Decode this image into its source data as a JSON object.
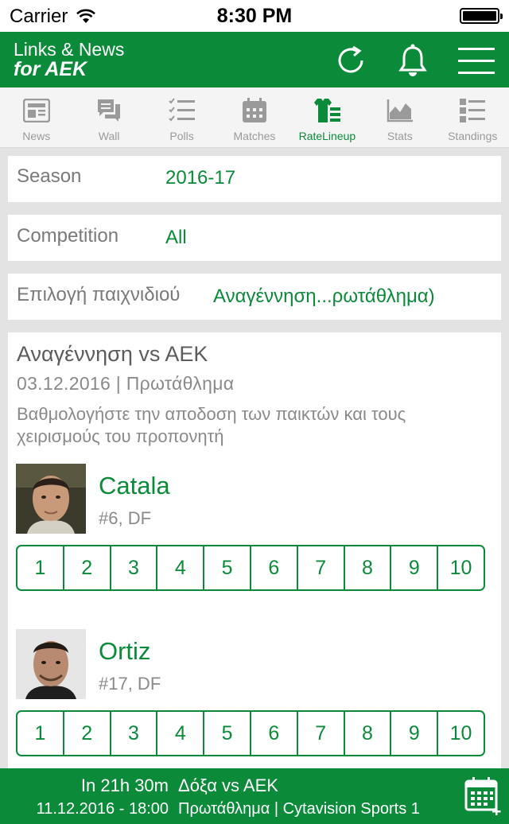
{
  "status_bar": {
    "carrier": "Carrier",
    "time": "8:30 PM"
  },
  "header": {
    "title_line1": "Links & News",
    "title_line2": "for AEK",
    "bg_color": "#0b8a3a",
    "icons": [
      "refresh-icon",
      "bell-icon",
      "menu-icon"
    ]
  },
  "tabs": [
    {
      "label": "News",
      "icon": "news-icon",
      "active": false
    },
    {
      "label": "Wall",
      "icon": "wall-icon",
      "active": false
    },
    {
      "label": "Polls",
      "icon": "polls-icon",
      "active": false
    },
    {
      "label": "Matches",
      "icon": "calendar-icon",
      "active": false
    },
    {
      "label": "RateLineup",
      "icon": "jersey-icon",
      "active": true
    },
    {
      "label": "Stats",
      "icon": "stats-icon",
      "active": false
    },
    {
      "label": "Standings",
      "icon": "standings-icon",
      "active": false
    }
  ],
  "filters": {
    "season": {
      "label": "Season",
      "value": "2016-17"
    },
    "competition": {
      "label": "Competition",
      "value": "All"
    },
    "game": {
      "label": "Επιλογή παιχνιδιού",
      "value": "Αναγέννηση...ρωτάθλημα)"
    }
  },
  "match": {
    "title": "Αναγέννηση vs AEK",
    "meta": "03.12.2016 | Πρωτάθλημα",
    "instructions": "Βαθμολογήστε την αποδοση των παικτών και τους χειρισμούς του προπονητή"
  },
  "players": [
    {
      "name": "Catala",
      "info": "#6, DF"
    },
    {
      "name": "Ortiz",
      "info": "#17, DF"
    }
  ],
  "ratings": [
    "1",
    "2",
    "3",
    "4",
    "5",
    "6",
    "7",
    "8",
    "9",
    "10"
  ],
  "next_match": {
    "countdown": "In 21h 30m",
    "name": "Δόξα vs AEK",
    "datetime": "11.12.2016 - 18:00",
    "broadcast": "Πρωτάθλημα | Cytavision Sports 1"
  },
  "colors": {
    "accent": "#0b8a3a",
    "inactive": "#9a9a9a"
  }
}
